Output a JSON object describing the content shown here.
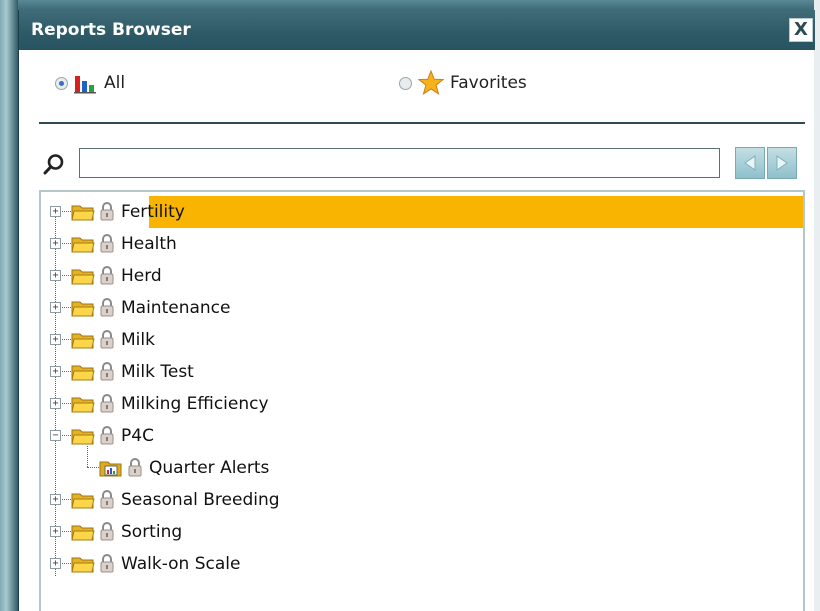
{
  "window": {
    "title": "Reports Browser",
    "close_label": "X"
  },
  "filter": {
    "all_label": "All",
    "favorites_label": "Favorites",
    "selected": "All"
  },
  "search": {
    "value": "",
    "placeholder": ""
  },
  "tree": {
    "items": [
      {
        "label": "Fertility",
        "level": 0,
        "expanded": false,
        "selected": true
      },
      {
        "label": "Health",
        "level": 0,
        "expanded": false,
        "selected": false
      },
      {
        "label": "Herd",
        "level": 0,
        "expanded": false,
        "selected": false
      },
      {
        "label": "Maintenance",
        "level": 0,
        "expanded": false,
        "selected": false
      },
      {
        "label": "Milk",
        "level": 0,
        "expanded": false,
        "selected": false
      },
      {
        "label": "Milk Test",
        "level": 0,
        "expanded": false,
        "selected": false
      },
      {
        "label": "Milking Efficiency",
        "level": 0,
        "expanded": false,
        "selected": false
      },
      {
        "label": "P4C",
        "level": 0,
        "expanded": true,
        "selected": false
      },
      {
        "label": "Quarter Alerts",
        "level": 1,
        "expanded": false,
        "selected": false
      },
      {
        "label": "Seasonal Breeding",
        "level": 0,
        "expanded": false,
        "selected": false
      },
      {
        "label": "Sorting",
        "level": 0,
        "expanded": false,
        "selected": false
      },
      {
        "label": "Walk-on Scale",
        "level": 0,
        "expanded": false,
        "selected": false
      }
    ]
  },
  "colors": {
    "titlebar": "#2e5b67",
    "selection": "#f8b400",
    "folder": "#f5c83a"
  },
  "icons": {
    "all": "bar-chart-icon",
    "favorites": "star-icon",
    "search": "magnifier-icon",
    "prev": "arrow-left-icon",
    "next": "arrow-right-icon",
    "folder": "folder-icon",
    "report": "report-folder-icon",
    "lock": "lock-icon"
  }
}
